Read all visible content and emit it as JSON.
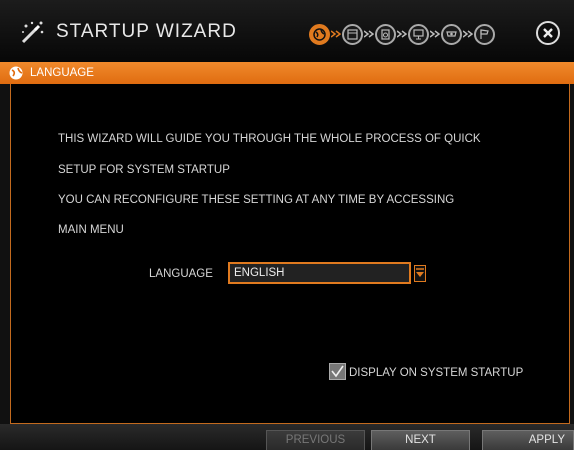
{
  "window": {
    "title": "STARTUP WIZARD",
    "logo_icon": "magic-wand-icon",
    "close_icon": "close-icon"
  },
  "steps": [
    {
      "icon": "globe-icon",
      "active": true
    },
    {
      "icon": "calendar-icon",
      "active": false
    },
    {
      "icon": "disk-icon",
      "active": false
    },
    {
      "icon": "monitor-icon",
      "active": false
    },
    {
      "icon": "camera-icon",
      "active": false
    },
    {
      "icon": "flag-icon",
      "active": false
    }
  ],
  "section": {
    "label": "LANGUAGE",
    "icon": "globe-icon"
  },
  "content": {
    "lines": [
      "THIS WIZARD WILL GUIDE YOU THROUGH THE WHOLE PROCESS OF QUICK",
      "SETUP FOR SYSTEM STARTUP",
      "YOU CAN RECONFIGURE THESE SETTING AT ANY TIME BY ACCESSING",
      "MAIN MENU"
    ],
    "language_label": "LANGUAGE",
    "language_value": "ENGLISH",
    "display_on_startup_label": "DISPLAY ON SYSTEM STARTUP",
    "display_on_startup_checked": true
  },
  "buttons": {
    "previous": "PREVIOUS",
    "next": "NEXT",
    "apply": "APPLY"
  },
  "colors": {
    "accent": "#e07a1f",
    "background": "#000000",
    "text": "#d6d6d6"
  }
}
